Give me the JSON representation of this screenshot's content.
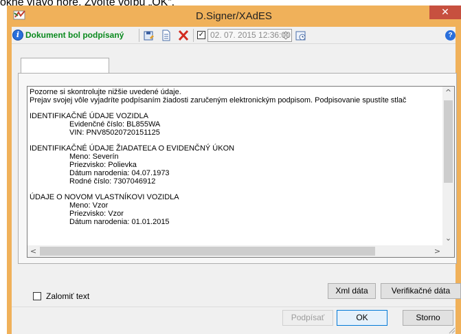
{
  "background": {
    "caption": "okne vľavo hore. Zvoľte voľbu „OK“."
  },
  "window": {
    "title": "D.Signer/XAdES",
    "close_glyph": "✕",
    "accent_color": "#f0b15a",
    "close_color": "#c7503f"
  },
  "toolbar": {
    "status_icon": "info-icon",
    "status_text": "Dokument bol podpísaný",
    "status_color": "#0a8a1e",
    "timestamp_checked": true,
    "timestamp": "02. 07. 2015 12:36:00",
    "icons": [
      "save-icon",
      "document-icon",
      "delete-icon",
      "calendar-icon",
      "help-icon"
    ]
  },
  "tab": {
    "label": ""
  },
  "document_text": {
    "lines": [
      "Pozorne si skontrolujte nižšie uvedené údaje.",
      "Prejav svojej vôle vyjadríte podpísaním žiadosti zaručeným elektronickým podpisom. Podpisovanie spustíte stlač"
    ],
    "vehicle_heading": "IDENTIFIKAČNÉ ÚDAJE VOZIDLA",
    "vehicle": [
      "Evidenčné číslo: BL855WA",
      "VIN: PNV85020720151125"
    ],
    "applicant_heading": "IDENTIFIKAČNÉ ÚDAJE ŽIADATEĽA O EVIDENČNÝ ÚKON",
    "applicant": [
      "Meno: Severín",
      "Priezvisko: Polievka",
      "Dátum narodenia: 04.07.1973",
      "Rodné číslo: 7307046912"
    ],
    "owner_heading": "ÚDAJE O NOVOM VLASTNÍKOVI VOZIDLA",
    "owner": [
      "Meno: Vzor",
      "Priezvisko: Vzor",
      "Dátum narodenia: 01.01.2015"
    ]
  },
  "scrollbars": {
    "up": "^",
    "down": "⌄",
    "left": "<",
    "right": ">"
  },
  "options": {
    "wrap_label": "Zalomiť text",
    "wrap_checked": false
  },
  "buttons": {
    "xml": "Xml dáta",
    "verification": "Verifikačné dáta",
    "sign": "Podpísať",
    "ok": "OK",
    "cancel": "Storno"
  }
}
